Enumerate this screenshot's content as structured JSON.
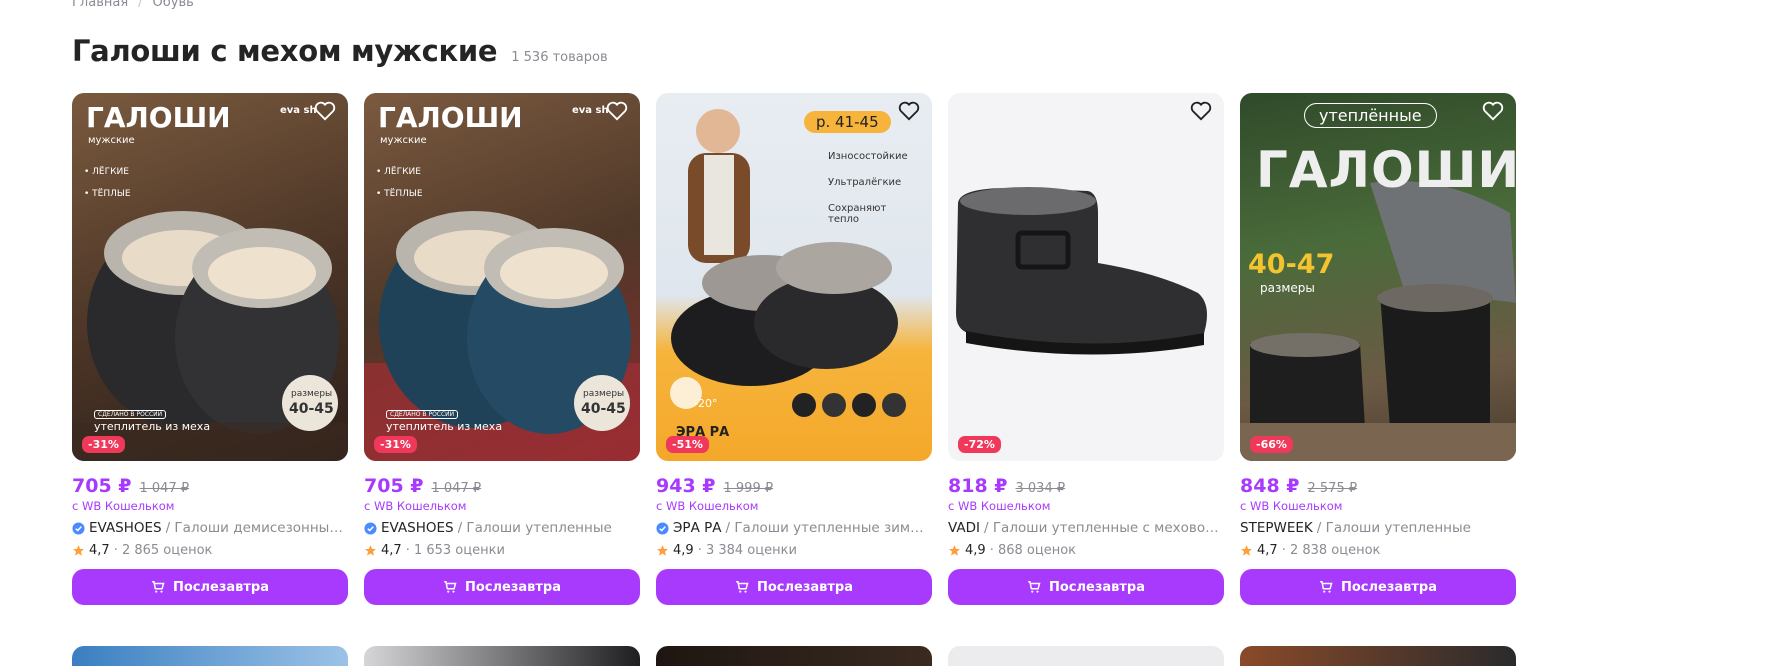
{
  "breadcrumb": {
    "home": "Главная",
    "sep": "/",
    "current": "Обувь"
  },
  "page": {
    "title": "Галоши с мехом мужские",
    "count": "1 536 товаров"
  },
  "colors": {
    "accent": "#a73afd",
    "discount": "#f0385a",
    "star": "#ff9f3a"
  },
  "products": [
    {
      "price": "705 ₽",
      "old_price": "1 047 ₽",
      "wallet": "с WB Кошельком",
      "brand": "EVASHOES",
      "title": "/ Галоши демисезонные и...",
      "verified": true,
      "rating": "4,7",
      "reviews": "· 2 865 оценок",
      "discount": "-31%",
      "button": "Послезавтра",
      "overlay": {
        "headline": "ГАЛОШИ",
        "sub": "мужские",
        "f1": "• ЛЁГКИЕ",
        "f2": "• ТЁПЛЫЕ",
        "logo": "eva sh",
        "made": "СДЕЛАНО В РОССИИ",
        "fur": "утеплитель из меха",
        "sizes_label": "размеры",
        "sizes": "40-45"
      }
    },
    {
      "price": "705 ₽",
      "old_price": "1 047 ₽",
      "wallet": "с WB Кошельком",
      "brand": "EVASHOES",
      "title": "/ Галоши утепленные",
      "verified": true,
      "rating": "4,7",
      "reviews": "· 1 653 оценки",
      "discount": "-31%",
      "button": "Послезавтра",
      "overlay": {
        "headline": "ГАЛОШИ",
        "sub": "мужские",
        "f1": "• ЛЁГКИЕ",
        "f2": "• ТЁПЛЫЕ",
        "logo": "eva sh",
        "made": "СДЕЛАНО В РОССИИ",
        "fur": "утеплитель из меха",
        "sizes_label": "размеры",
        "sizes": "40-45"
      }
    },
    {
      "price": "943 ₽",
      "old_price": "1 999 ₽",
      "wallet": "с WB Кошельком",
      "brand": "ЭРА РА",
      "title": "/ Галоши утепленные зимние ...",
      "verified": true,
      "rating": "4,9",
      "reviews": "· 3 384 оценки",
      "discount": "-51%",
      "button": "Послезавтра",
      "overlay": {
        "size_tag": "р. 41-45",
        "f1": "Износостойкие",
        "f2": "Ультралёгкие",
        "f3": "Сохраняют",
        "f3b": "тепло",
        "temp": "-20°",
        "brand_logo": "ЭРА РА"
      }
    },
    {
      "price": "818 ₽",
      "old_price": "3 034 ₽",
      "wallet": "с WB Кошельком",
      "brand": "VADI",
      "title": "/ Галоши утепленные с меховой на...",
      "verified": false,
      "rating": "4,9",
      "reviews": "· 868 оценок",
      "discount": "-72%",
      "button": "Послезавтра",
      "overlay": {}
    },
    {
      "price": "848 ₽",
      "old_price": "2 575 ₽",
      "wallet": "с WB Кошельком",
      "brand": "STEPWEEK",
      "title": "/ Галоши утепленные",
      "verified": false,
      "rating": "4,7",
      "reviews": "· 2 838 оценок",
      "discount": "-66%",
      "button": "Послезавтра",
      "overlay": {
        "pill": "утеплённые",
        "headline": "ГАЛОШИ",
        "sizes": "40-47",
        "sizes_label": "размеры"
      }
    }
  ]
}
